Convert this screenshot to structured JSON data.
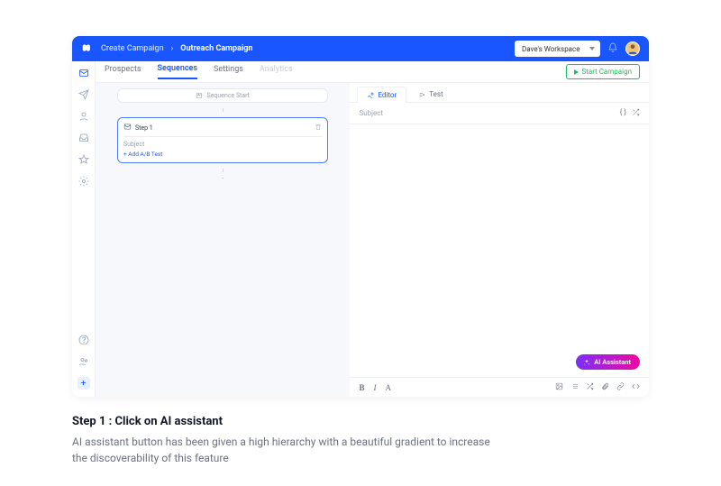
{
  "topbar": {
    "breadcrumb_root": "Create Campaign",
    "breadcrumb_current": "Outreach Campaign",
    "workspace": "Dave's Workspace"
  },
  "tabs": {
    "prospects": "Prospects",
    "sequences": "Sequences",
    "settings": "Settings",
    "analytics": "Analytics",
    "start": "Start Campaign"
  },
  "sequence": {
    "start_label": "Sequence Start",
    "step_label": "Step 1",
    "subject_label": "Subject",
    "add_ab": "+ Add A/B Test"
  },
  "editor": {
    "tab_editor": "Editor",
    "tab_test": "Test",
    "subject_placeholder": "Subject",
    "brackets": "{ }",
    "ai_button": "AI Assistant"
  },
  "caption": {
    "title": "Step 1 : Click on AI assistant",
    "body": "AI assistant button  has been given a high hierarchy with a beautiful gradient to increase the discoverability of this feature"
  }
}
